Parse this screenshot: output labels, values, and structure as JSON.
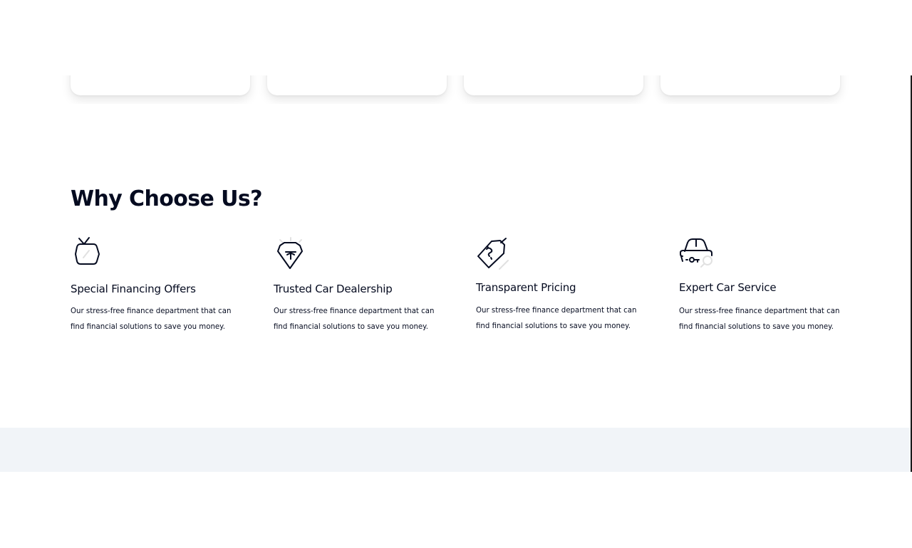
{
  "section": {
    "title": "Why Choose Us?"
  },
  "features": [
    {
      "icon": "tv-tag-icon",
      "title": "Special Financing Offers",
      "description": "Our stress-free finance department that can find financial solutions to save you money."
    },
    {
      "icon": "diamond-badge-icon",
      "title": "Trusted Car Dealership",
      "description": "Our stress-free finance department that can find financial solutions to save you money."
    },
    {
      "icon": "price-tag-icon",
      "title": "Transparent Pricing",
      "description": "Our stress-free finance department that can find financial solutions to save you money."
    },
    {
      "icon": "car-service-icon",
      "title": "Expert Car Service",
      "description": "Our stress-free finance department that can find financial solutions to save you money."
    }
  ],
  "colors": {
    "text": "#050b20",
    "band": "#f1f4f8",
    "icon_stroke": "#050b20",
    "icon_accent": "#e1e1e1"
  }
}
